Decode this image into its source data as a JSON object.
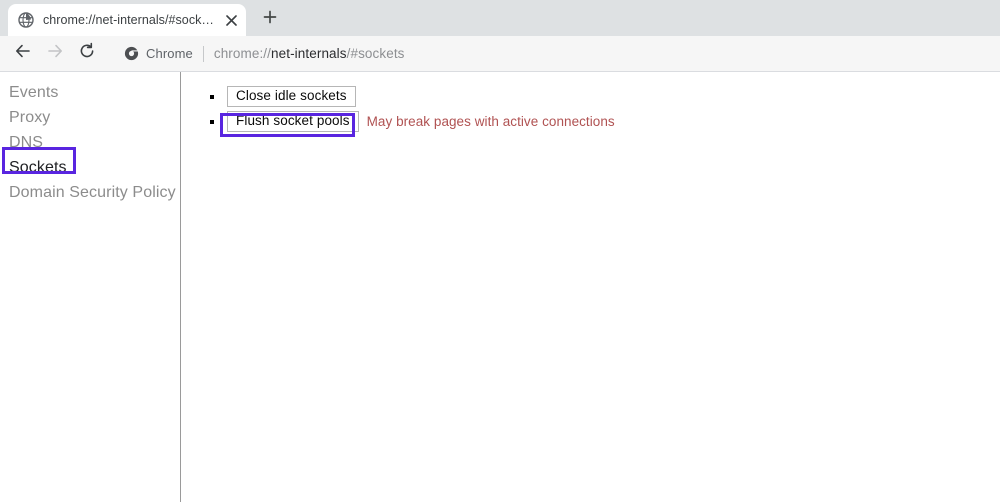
{
  "browser": {
    "tab": {
      "title": "chrome://net-internals/#sockets",
      "favicon_icon": "globe-icon",
      "close_icon": "close-icon"
    },
    "new_tab_icon": "plus-icon",
    "toolbar": {
      "back_icon": "arrow-left-icon",
      "forward_icon": "arrow-right-icon",
      "reload_icon": "reload-icon",
      "omnibox": {
        "chip_icon": "chrome-shield-icon",
        "chip_label": "Chrome",
        "url_prefix": "chrome://",
        "url_host": "net-internals",
        "url_suffix": "/#sockets",
        "full_url": "chrome://net-internals/#sockets"
      }
    }
  },
  "sidebar": {
    "items": [
      {
        "label": "Events",
        "selected": false
      },
      {
        "label": "Proxy",
        "selected": false
      },
      {
        "label": "DNS",
        "selected": false
      },
      {
        "label": "Sockets",
        "selected": true
      },
      {
        "label": "Domain Security Policy",
        "selected": false
      }
    ]
  },
  "main": {
    "actions": [
      {
        "button_label": "Close idle sockets",
        "note": ""
      },
      {
        "button_label": "Flush socket pools",
        "note": "May break pages with active connections"
      }
    ]
  },
  "annotations": {
    "color": "#5925e0",
    "boxes": [
      {
        "target": "sidebar-item-sockets"
      },
      {
        "target": "flush-socket-pools-button"
      }
    ]
  },
  "colors": {
    "tabstrip_bg": "#dee1e3",
    "toolbar_bg": "#f6f6f6",
    "page_bg": "#ffffff",
    "sidebar_text": "#8c8c8c",
    "sidebar_text_selected": "#202124",
    "warning_text": "#b05252",
    "annotation": "#5925e0"
  }
}
